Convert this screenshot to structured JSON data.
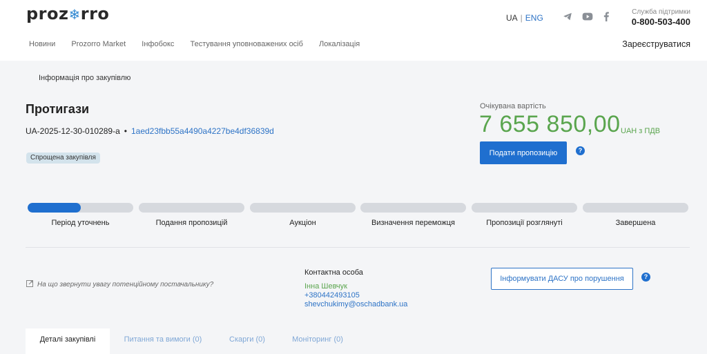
{
  "header": {
    "logo_text": "prozorro",
    "lang_active": "UA",
    "lang_other": "ENG",
    "support_label": "Служба підтримки",
    "support_phone": "0-800-503-400",
    "social_icons": [
      "telegram-icon",
      "youtube-icon",
      "facebook-icon"
    ],
    "nav": [
      "Новини",
      "Prozorro Market",
      "Інфобокс",
      "Тестування уповноважених осіб",
      "Локалізація"
    ],
    "register_label": "Зареєструватися"
  },
  "main": {
    "breadcrumb": "Інформація про закупівлю",
    "title": "Протигази",
    "tender_id": "UA-2025-12-30-010289-a",
    "hash_id": "1aed23fbb55a4490a4227be4df36839d",
    "badge": "Спрощена закупівля",
    "expected_label": "Очікувана вартість",
    "expected_value": "7 655 850,00",
    "expected_unit": "UAH з ПДВ",
    "submit_label": "Подати пропозицію",
    "help_symbol": "?"
  },
  "stages": [
    {
      "label": "Період уточнень",
      "progress": 0.5
    },
    {
      "label": "Подання пропозицій",
      "progress": 0
    },
    {
      "label": "Аукціон",
      "progress": 0
    },
    {
      "label": "Визначення переможця",
      "progress": 0
    },
    {
      "label": "Пропозиції розглянуті",
      "progress": 0
    },
    {
      "label": "Завершена",
      "progress": 0
    }
  ],
  "contact": {
    "hint": "На що звернути увагу потенційному постачальнику?",
    "title": "Контактна особа",
    "name": "Інна Шевчук",
    "phone": "+380442493105",
    "email": "shevchukimy@oschadbank.ua",
    "dasu_label": "Інформувати ДАСУ про порушення"
  },
  "tabs": [
    {
      "label": "Деталі закупівлі",
      "active": true
    },
    {
      "label": "Питання та вимоги (0)",
      "active": false
    },
    {
      "label": "Скарги (0)",
      "active": false
    },
    {
      "label": "Моніторинг (0)",
      "active": false
    }
  ],
  "colors": {
    "accent_blue": "#1f6fcf",
    "value_green": "#5aa54e",
    "background_grey": "#f4f5f7"
  }
}
